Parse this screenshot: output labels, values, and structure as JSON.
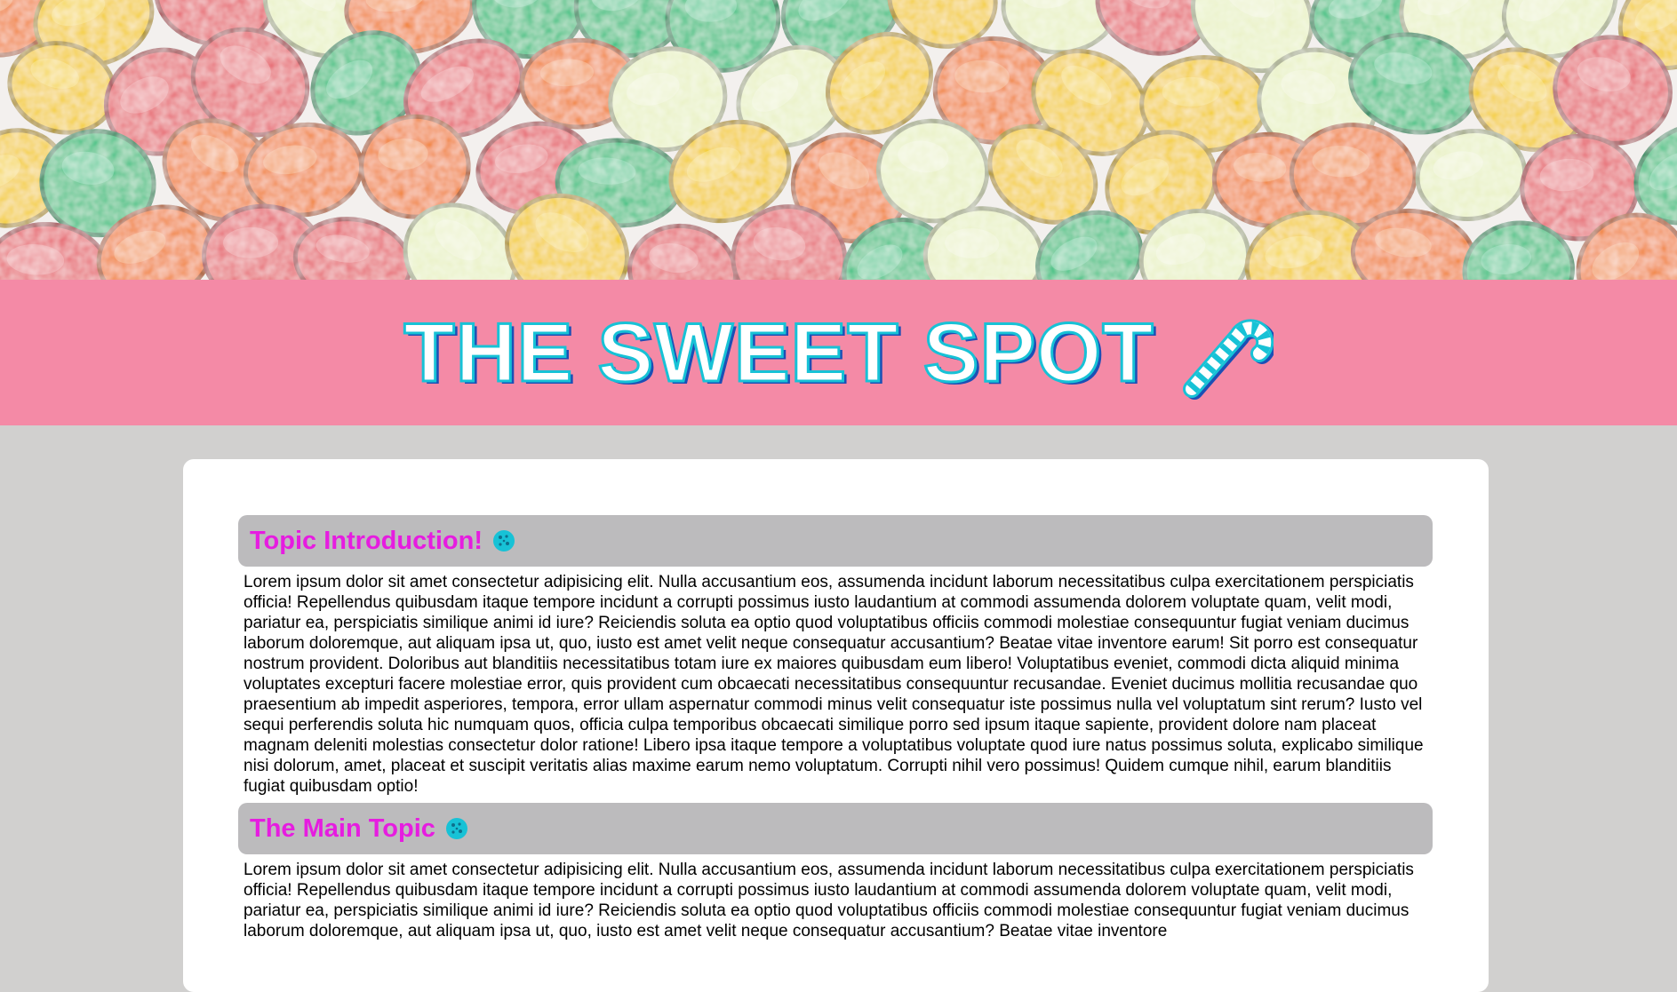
{
  "hero": {
    "image": "candy-photo",
    "colors": [
      "#e8737a",
      "#4fc489",
      "#f28a4c",
      "#f4cf3a",
      "#eaf2c8"
    ]
  },
  "banner": {
    "title": "THE SWEET SPOT",
    "icon": "candy-cane-icon",
    "background": "#f48aa6"
  },
  "sections": [
    {
      "title": "Topic Introduction!",
      "icon": "cookie-icon",
      "body": "Lorem ipsum dolor sit amet consectetur adipisicing elit. Nulla accusantium eos, assumenda incidunt laborum necessitatibus culpa exercitationem perspiciatis officia! Repellendus quibusdam itaque tempore incidunt a corrupti possimus iusto laudantium at commodi assumenda dolorem voluptate quam, velit modi, pariatur ea, perspiciatis similique animi id iure? Reiciendis soluta ea optio quod voluptatibus officiis commodi molestiae consequuntur fugiat veniam ducimus laborum doloremque, aut aliquam ipsa ut, quo, iusto est amet velit neque consequatur accusantium? Beatae vitae inventore earum! Sit porro est consequatur nostrum provident. Doloribus aut blanditiis necessitatibus totam iure ex maiores quibusdam eum libero! Voluptatibus eveniet, commodi dicta aliquid minima voluptates excepturi facere molestiae error, quis provident cum obcaecati necessitatibus consequuntur recusandae. Eveniet ducimus mollitia recusandae quo praesentium ab impedit asperiores, tempora, error ullam aspernatur commodi minus velit consequatur iste possimus nulla vel voluptatum sint rerum? Iusto vel sequi perferendis soluta hic numquam quos, officia culpa temporibus obcaecati similique porro sed ipsum itaque sapiente, provident dolore nam placeat magnam deleniti molestias consectetur dolor ratione! Libero ipsa itaque tempore a voluptatibus voluptate quod iure natus possimus soluta, explicabo similique nisi dolorum, amet, placeat et suscipit veritatis alias maxime earum nemo voluptatum. Corrupti nihil vero possimus! Quidem cumque nihil, earum blanditiis fugiat quibusdam optio!"
    },
    {
      "title": "The Main Topic",
      "icon": "cookie-icon",
      "body": "Lorem ipsum dolor sit amet consectetur adipisicing elit. Nulla accusantium eos, assumenda incidunt laborum necessitatibus culpa exercitationem perspiciatis officia! Repellendus quibusdam itaque tempore incidunt a corrupti possimus iusto laudantium at commodi assumenda dolorem voluptate quam, velit modi, pariatur ea, perspiciatis similique animi id iure? Reiciendis soluta ea optio quod voluptatibus officiis commodi molestiae consequuntur fugiat veniam ducimus laborum doloremque, aut aliquam ipsa ut, quo, iusto est amet velit neque consequatur accusantium? Beatae vitae inventore"
    }
  ],
  "colors": {
    "page_background": "#d1d0cf",
    "card_background": "#ffffff",
    "section_header_background": "#bcbbbd",
    "section_title": "#e61ce0",
    "icon_accent": "#17c2d6"
  }
}
